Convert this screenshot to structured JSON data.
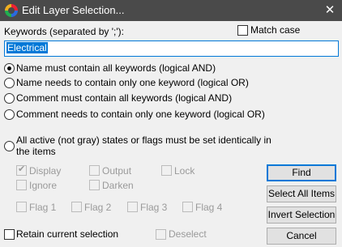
{
  "window": {
    "title": "Edit Layer Selection...",
    "close_symbol": "✕"
  },
  "keywords": {
    "label": "Keywords (separated by ';'):",
    "value": "Electrical",
    "match_case_label": "Match case",
    "match_case_checked": false
  },
  "modes": [
    {
      "label": "Name must contain all keywords (logical AND)",
      "selected": true
    },
    {
      "label": "Name needs to contain only one keyword (logical OR)",
      "selected": false
    },
    {
      "label": "Comment must contain all keywords (logical AND)",
      "selected": false
    },
    {
      "label": "Comment needs to contain only one keyword (logical OR)",
      "selected": false
    },
    {
      "label": "All active (not gray) states or flags must be set identically in the items",
      "selected": false
    }
  ],
  "states": {
    "display": "Display",
    "output": "Output",
    "lock": "Lock",
    "ignore": "Ignore",
    "darken": "Darken",
    "flag1": "Flag 1",
    "flag2": "Flag 2",
    "flag3": "Flag 3",
    "flag4": "Flag 4"
  },
  "buttons": {
    "find": "Find",
    "select_all": "Select All Items",
    "invert": "Invert Selection",
    "cancel": "Cancel"
  },
  "footer": {
    "retain_label": "Retain current selection",
    "deselect_label": "Deselect"
  },
  "icons": {
    "app": "app-logo-icon",
    "close": "close-icon",
    "check": "checkmark-icon"
  },
  "colors": {
    "titlebar": "#4a4a4a",
    "accent": "#0078d7",
    "disabled_text": "#9a9a9a"
  }
}
